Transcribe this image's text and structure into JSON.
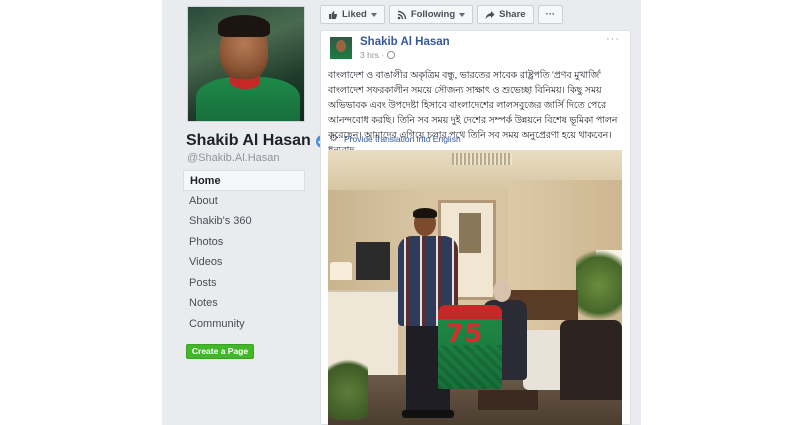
{
  "page": {
    "name": "Shakib Al Hasan",
    "handle": "@Shakib.Al.Hasan"
  },
  "nav": {
    "items": [
      {
        "label": "Home",
        "active": true
      },
      {
        "label": "About"
      },
      {
        "label": "Shakib's 360"
      },
      {
        "label": "Photos"
      },
      {
        "label": "Videos"
      },
      {
        "label": "Posts"
      },
      {
        "label": "Notes"
      },
      {
        "label": "Community"
      }
    ],
    "create_page_label": "Create a Page"
  },
  "actions": {
    "liked_label": "Liked",
    "following_label": "Following",
    "share_label": "Share",
    "more_label": "···"
  },
  "post": {
    "author": "Shakib Al Hasan",
    "time": "3 hrs ·",
    "more_options": "···",
    "text": "বাংলাদেশ ও বাঙালীর অকৃত্রিম বন্ধু, ভারতের সাবেক রাষ্ট্রপতি 'প্রণব মুখার্জি' বাংলাদেশ সফরকালীন সময়ে সৌজন্য সাক্ষাৎ ও শুভেচ্ছা বিনিময়। কিছু সময় অভিভাবক এবং উপদেষ্টা হিসাবে বাংলাদেশের লালসবুজের জার্সি দিতে পেরে আনন্দবোধ করছি। তিনি সব সময় দুই দেশের সম্পর্ক উন্নয়নে বিশেষ ভূমিকা পালন করেছেন। আমাদের এগিয়ে চলার পথে তিনি সব সময় অনুপ্রেরণা হয়ে থাকবেন। ধন্যবাদ",
    "translate_label": "Provide translation into English",
    "jersey_number": "75"
  },
  "colors": {
    "link": "#365899",
    "create_button": "#42b72a",
    "verified": "#4a90e2"
  }
}
